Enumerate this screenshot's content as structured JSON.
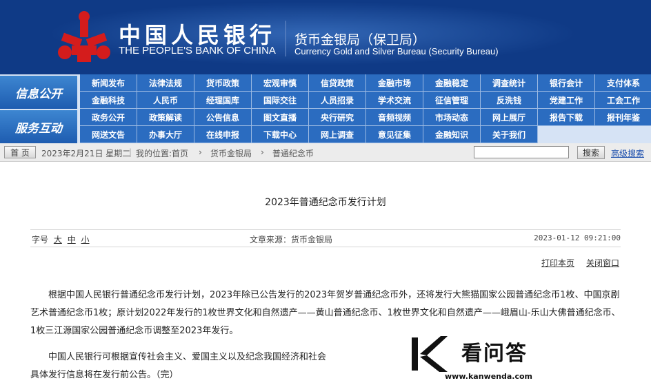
{
  "header": {
    "bank_cn": "中国人民银行",
    "bank_en": "THE PEOPLE'S BANK OF CHINA",
    "bureau_cn": "货币金银局（保卫局）",
    "bureau_en": "Currency  Gold and Silver Bureau (Security Bureau)",
    "brand_color": "#0f3a86",
    "logo_color": "#d41c1c"
  },
  "nav": {
    "section1": "信息公开",
    "section2": "服务互动",
    "rows": [
      [
        "新闻发布",
        "法律法规",
        "货币政策",
        "宏观审慎",
        "信贷政策",
        "金融市场",
        "金融稳定",
        "调查统计",
        "银行会计",
        "支付体系"
      ],
      [
        "金融科技",
        "人民币",
        "经理国库",
        "国际交往",
        "人员招录",
        "学术交流",
        "征信管理",
        "反洗钱",
        "党建工作",
        "工会工作"
      ],
      [
        "政务公开",
        "政策解读",
        "公告信息",
        "图文直播",
        "央行研究",
        "音频视频",
        "市场动态",
        "网上展厅",
        "报告下载",
        "报刊年鉴"
      ],
      [
        "网送文告",
        "办事大厅",
        "在线申报",
        "下载中心",
        "网上调查",
        "意见征集",
        "金融知识",
        "关于我们"
      ]
    ]
  },
  "crumbs": {
    "home": "首 页",
    "date": "2023年2月21日 星期二",
    "location": "我的位置:首页",
    "level1": "货币金银局",
    "level2": "普通纪念币",
    "search_btn": "搜索",
    "advanced": "高级搜索"
  },
  "article": {
    "title": "2023年普通纪念币发行计划",
    "font_label": "字号",
    "font_large": "大",
    "font_medium": "中",
    "font_small": "小",
    "source": "文章来源：货币金银局",
    "datetime": "2023-01-12 09:21:00",
    "print": "打印本页",
    "close": "关闭窗口",
    "para1": "根据中国人民银行普通纪念币发行计划，2023年除已公告发行的2023年贺岁普通纪念币外，还将发行大熊猫国家公园普通纪念币1枚、中国京剧艺术普通纪念币1枚；原计划2022年发行的1枚世界文化和自然遗产——黄山普通纪念币、1枚世界文化和自然遗产——峨眉山-乐山大佛普通纪念币、1枚三江源国家公园普通纪念币调整至2023年发行。",
    "para2": "中国人民银行可根据宣传社会主义、爱国主义以及纪念我国经济和社会",
    "para2b": "具体发行信息将在发行前公告。（完）"
  },
  "watermark": {
    "text": "看问答",
    "url": "www.kanwenda.com"
  }
}
